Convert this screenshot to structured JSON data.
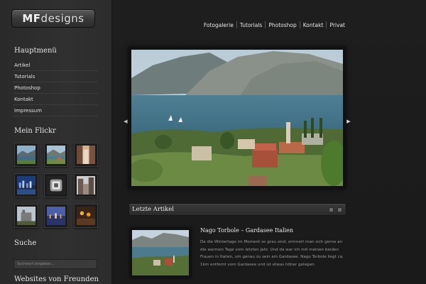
{
  "logo": {
    "part1": "MF",
    "part2": "designs"
  },
  "sidebar": {
    "main_menu_heading": "Hauptmenü",
    "menu_items": [
      "Artikel",
      "Tutorials",
      "Photoshop",
      "Kontakt",
      "Impressum"
    ],
    "flickr_heading": "Mein Flickr",
    "flickr_thumbs": [
      "lake-landscape",
      "lake-mountains",
      "canyon-street",
      "city-skyline-night",
      "tunnel-interior",
      "street-buildings",
      "castle-ruin",
      "city-dusk",
      "interior-lights"
    ],
    "search_heading": "Suche",
    "search_placeholder": "Suchwort eingeben...",
    "friends_heading": "Websites von Freunden"
  },
  "topnav": {
    "items": [
      "Fotogalerie",
      "Tutorials",
      "Photoshop",
      "Kontakt",
      "Privat"
    ]
  },
  "slider": {
    "image": "lake-garda-village",
    "prev_icon": "arrow-left-icon",
    "next_icon": "arrow-right-icon"
  },
  "latest": {
    "heading": "Letzte Artikel",
    "pages": 2
  },
  "article": {
    "title": "Nago Torbole – Gardasee Italien",
    "excerpt": "Da die Wintertage im Moment so grau sind, erinnert man sich gerne an die warmen Tage vom letzten Jahr. Und da war ich mit meinen beiden Frauen in Italien, um genau zu sein am Gardasee. Nago Torbole liegt ca. 1km entfernt vom Gardasee und ist etwas höher gelegen."
  },
  "colors": {
    "background": "#1b1b1b",
    "sidebar": "#2e2e2e",
    "text": "#e0e0e0"
  }
}
